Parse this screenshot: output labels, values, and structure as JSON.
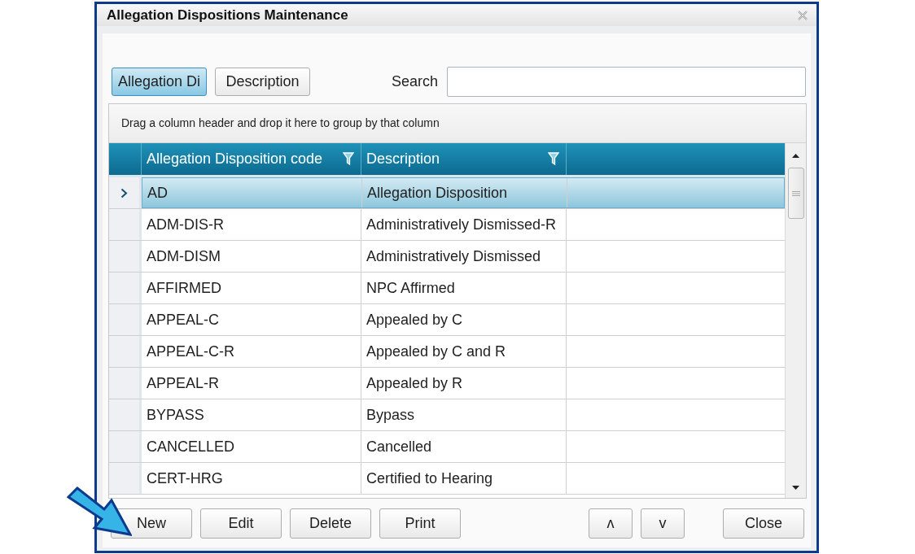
{
  "window": {
    "title": "Allegation Dispositions Maintenance"
  },
  "toolbar": {
    "sort_toggles": [
      {
        "label": "Allegation Di",
        "selected": true
      },
      {
        "label": "Description",
        "selected": false
      }
    ],
    "search": {
      "label": "Search"
    }
  },
  "grid": {
    "group_hint": "Drag a column header and drop it here to group by that column",
    "columns": [
      {
        "label": "Allegation Disposition code"
      },
      {
        "label": "Description"
      }
    ],
    "rows": [
      {
        "cells": [
          "AD",
          "Allegation Disposition"
        ],
        "selected": true
      },
      {
        "cells": [
          "ADM-DIS-R",
          "Administratively Dismissed-R"
        ],
        "selected": false
      },
      {
        "cells": [
          "ADM-DISM",
          "Administratively Dismissed"
        ],
        "selected": false
      },
      {
        "cells": [
          "AFFIRMED",
          "NPC Affirmed"
        ],
        "selected": false
      },
      {
        "cells": [
          "APPEAL-C",
          "Appealed by C"
        ],
        "selected": false
      },
      {
        "cells": [
          "APPEAL-C-R",
          "Appealed by C and R"
        ],
        "selected": false
      },
      {
        "cells": [
          "APPEAL-R",
          "Appealed by R"
        ],
        "selected": false
      },
      {
        "cells": [
          "BYPASS",
          "Bypass"
        ],
        "selected": false
      },
      {
        "cells": [
          "CANCELLED",
          "Cancelled"
        ],
        "selected": false
      },
      {
        "cells": [
          "CERT-HRG",
          "Certified to Hearing"
        ],
        "selected": false
      }
    ]
  },
  "actions": [
    {
      "label": "New"
    },
    {
      "label": "Edit"
    },
    {
      "label": "Delete"
    },
    {
      "label": "Print"
    }
  ],
  "move_buttons": [
    {
      "label": "ʌ"
    },
    {
      "label": "v"
    }
  ],
  "close_button": {
    "label": "Close"
  }
}
